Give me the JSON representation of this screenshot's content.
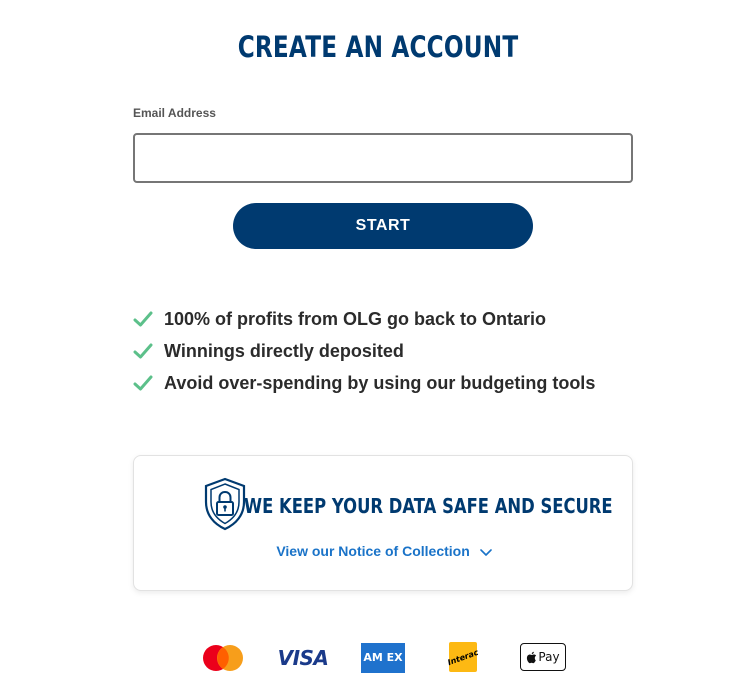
{
  "page": {
    "title": "CREATE AN ACCOUNT"
  },
  "form": {
    "email_label": "Email Address",
    "email_value": "",
    "email_placeholder": "",
    "start_label": "START"
  },
  "benefits": [
    {
      "icon": "check-icon",
      "text": "100% of profits from OLG go back to Ontario"
    },
    {
      "icon": "check-icon",
      "text": "Winnings directly deposited"
    },
    {
      "icon": "check-icon",
      "text": "Avoid over-spending by using our budgeting tools"
    }
  ],
  "security": {
    "icon": "shield-lock-icon",
    "title": "WE KEEP YOUR DATA SAFE AND SECURE",
    "notice_link": "View our Notice of Collection",
    "notice_icon": "chevron-down-icon"
  },
  "payments": {
    "visa": "VISA",
    "amex": "AM EX",
    "interac": "Interac",
    "applepay": "Pay"
  },
  "colors": {
    "brand_navy": "#003a70",
    "check_green": "#5cc08a",
    "link_blue": "#1a73c8"
  }
}
